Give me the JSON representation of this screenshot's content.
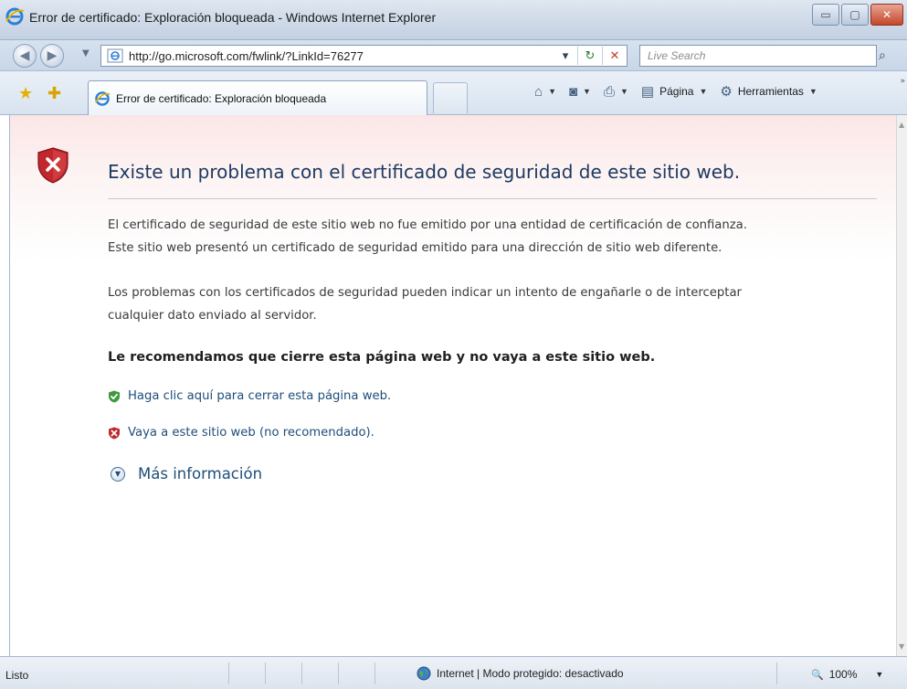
{
  "window": {
    "title": "Error de certificado: Exploración bloqueada - Windows Internet Explorer",
    "minimize_glyph": "▭",
    "maximize_glyph": "▢",
    "close_glyph": "✕"
  },
  "nav": {
    "back_glyph": "◀",
    "forward_glyph": "▶",
    "dropdown_glyph": "▼",
    "address": "http://go.microsoft.com/fwlink/?LinkId=76277",
    "address_dropdown_glyph": "▾",
    "refresh_glyph": "↻",
    "stop_glyph": "✕",
    "search_placeholder": "Live Search",
    "search_glyph": "⌕"
  },
  "commandbar": {
    "favorites_glyph": "★",
    "add_favorites_glyph": "✚",
    "tab_label": "Error de certificado: Exploración bloqueada",
    "home_glyph": "⌂",
    "feeds_glyph": "◙",
    "print_glyph": "⎙",
    "page_icon_glyph": "▤",
    "page_label": "Página",
    "tools_icon_glyph": "⚙",
    "tools_label": "Herramientas",
    "dropdown_glyph": "▼",
    "more_glyph": "»"
  },
  "content": {
    "headline": "Existe un problema con el certificado de seguridad de este sitio web.",
    "paragraph1_line1": "El certificado de seguridad de este sitio web no fue emitido por una entidad de certificación de confianza.",
    "paragraph1_line2": "Este sitio web presentó un certificado de seguridad emitido para una dirección de sitio web diferente.",
    "paragraph2_line1": "Los problemas con los certificados de seguridad pueden indicar un intento de engañarle o de interceptar",
    "paragraph2_line2": "cualquier dato enviado al servidor.",
    "recommendation": "Le recomendamos que cierre esta página web y no vaya a este sitio web.",
    "close_page_link": "Haga clic aquí para cerrar esta página web.",
    "continue_link": "Vaya a este sitio web (no recomendado).",
    "more_info": "Más información",
    "more_info_glyph": "▼"
  },
  "statusbar": {
    "status_text": "Listo",
    "zone_text": "Internet | Modo protegido: desactivado",
    "zoom_glyph": "🔍",
    "zoom_level": "100%",
    "zoom_dropdown_glyph": "▼"
  },
  "scrollbar": {
    "up_glyph": "▲",
    "down_glyph": "▼"
  },
  "colors": {
    "headline": "#1d3a62",
    "link": "#1e4e7a",
    "danger_shield": "#c0282e",
    "safe_shield": "#3e9a3c",
    "page_top_tint": "#fbe6e6"
  }
}
